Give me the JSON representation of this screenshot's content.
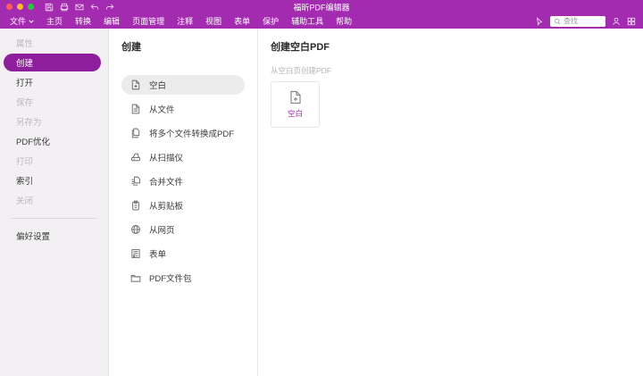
{
  "titlebar": {
    "title": "福昕PDF编辑器"
  },
  "menubar": {
    "items": [
      "文件",
      "主页",
      "转换",
      "编辑",
      "页面管理",
      "注释",
      "视图",
      "表单",
      "保护",
      "辅助工具",
      "帮助"
    ],
    "search_placeholder": "查找"
  },
  "sidebar": {
    "items": [
      {
        "label": "属性",
        "state": "disabled"
      },
      {
        "label": "创建",
        "state": "selected"
      },
      {
        "label": "打开",
        "state": "normal"
      },
      {
        "label": "保存",
        "state": "disabled"
      },
      {
        "label": "另存为",
        "state": "disabled"
      },
      {
        "label": "PDF优化",
        "state": "normal"
      },
      {
        "label": "打印",
        "state": "disabled"
      },
      {
        "label": "索引",
        "state": "normal"
      },
      {
        "label": "关闭",
        "state": "disabled"
      }
    ],
    "footer_item": {
      "label": "偏好设置",
      "state": "normal"
    }
  },
  "create_panel": {
    "title": "创建",
    "items": [
      {
        "label": "空白",
        "icon": "blank-page-icon",
        "selected": true
      },
      {
        "label": "从文件",
        "icon": "from-file-icon",
        "selected": false
      },
      {
        "label": "将多个文件转换成PDF",
        "icon": "multiple-files-icon",
        "selected": false
      },
      {
        "label": "从扫描仪",
        "icon": "scanner-icon",
        "selected": false
      },
      {
        "label": "合并文件",
        "icon": "combine-files-icon",
        "selected": false
      },
      {
        "label": "从剪贴板",
        "icon": "clipboard-icon",
        "selected": false
      },
      {
        "label": "从网页",
        "icon": "webpage-icon",
        "selected": false
      },
      {
        "label": "表单",
        "icon": "form-icon",
        "selected": false
      },
      {
        "label": "PDF文件包",
        "icon": "portfolio-icon",
        "selected": false
      }
    ]
  },
  "detail_panel": {
    "title": "创建空白PDF",
    "subtitle": "从空白页创建PDF",
    "card_label": "空白"
  },
  "colors": {
    "titlebar_purple": "#a32bb0",
    "selected_pill_purple": "#8d1f9c",
    "accent": "#a32bb0",
    "sidebar_bg": "#f2f0f2",
    "selected_row_gray": "#ececec",
    "disabled_text": "#bdb9bd"
  }
}
